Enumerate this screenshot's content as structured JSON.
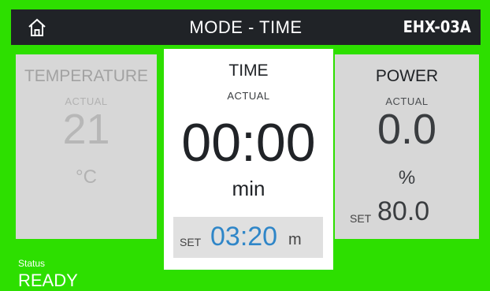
{
  "header": {
    "home_icon": "home-icon",
    "title": "MODE - TIME",
    "model": "EHX-03A"
  },
  "temperature": {
    "title": "TEMPERATURE",
    "actual_label": "ACTUAL",
    "actual_value": "21",
    "unit": "°C"
  },
  "time": {
    "title": "TIME",
    "actual_label": "ACTUAL",
    "actual_value": "00:00",
    "unit": "min",
    "set_label": "SET",
    "set_value": "03:20",
    "set_unit": "m"
  },
  "power": {
    "title": "POWER",
    "actual_label": "ACTUAL",
    "actual_value": "0.0",
    "unit": "%",
    "set_label": "SET",
    "set_value": "80.0"
  },
  "status": {
    "label": "Status",
    "value": "READY"
  },
  "colors": {
    "background": "#2ddf00",
    "topbar": "#202327",
    "accent_blue": "#2f86c8"
  }
}
